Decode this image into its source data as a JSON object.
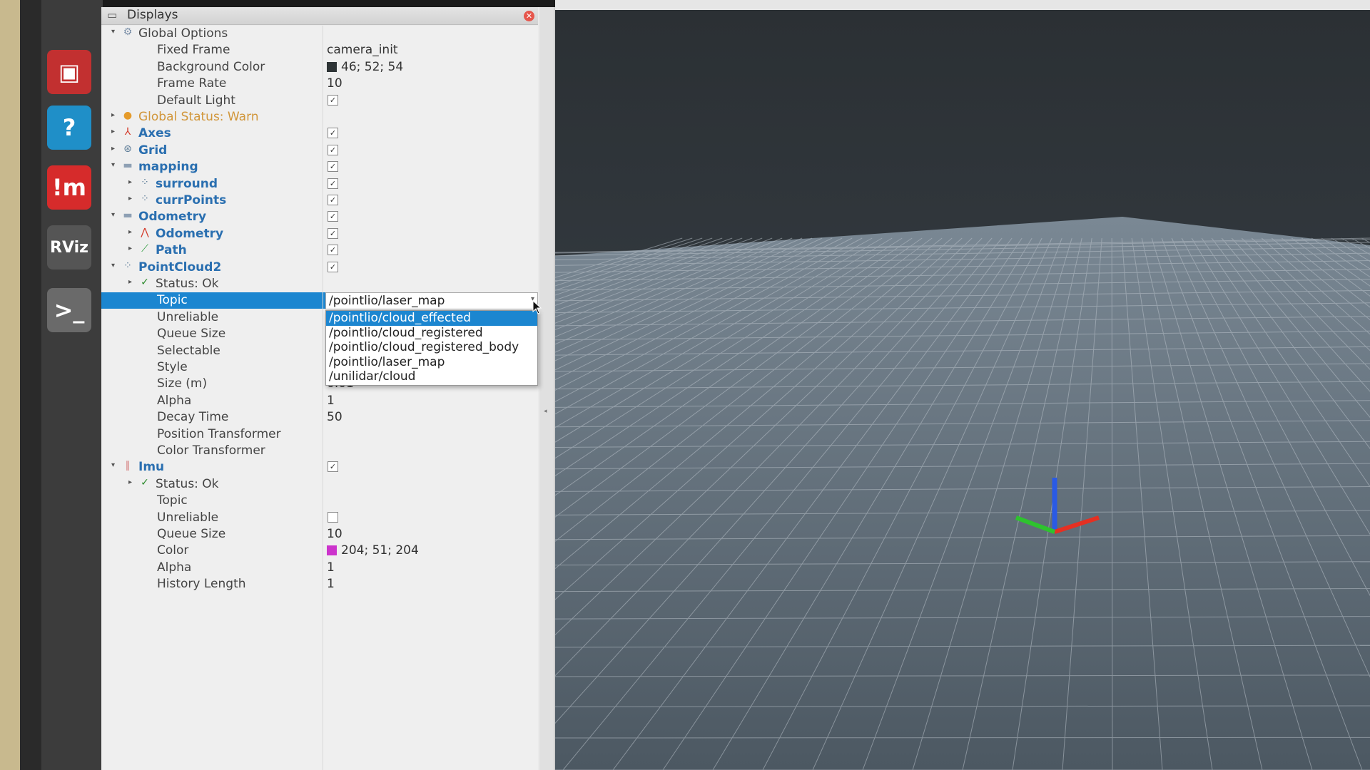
{
  "panel": {
    "title": "Displays"
  },
  "tree": [
    {
      "label": "Global Options",
      "arrow": "▾",
      "indent": 0,
      "icon": "gear-icon",
      "glyph": "⚙",
      "iconColor": "#7a8fa8",
      "style": "plain"
    },
    {
      "label": "Fixed Frame",
      "indent": 2,
      "value": "camera_init"
    },
    {
      "label": "Background Color",
      "indent": 2,
      "value": "46; 52; 54",
      "swatch": "#2e3436"
    },
    {
      "label": "Frame Rate",
      "indent": 2,
      "value": "10"
    },
    {
      "label": "Default Light",
      "indent": 2,
      "checkbox": true
    },
    {
      "label": "Global Status: Warn",
      "arrow": "▸",
      "indent": 0,
      "icon": "warning-icon",
      "glyph": "●",
      "iconColor": "#e59b2b",
      "style": "warn"
    },
    {
      "label": "Axes",
      "arrow": "▸",
      "indent": 0,
      "icon": "axes-icon",
      "glyph": "⅄",
      "iconColor": "#d43a2a",
      "style": "bold",
      "checkbox": true
    },
    {
      "label": "Grid",
      "arrow": "▸",
      "indent": 0,
      "icon": "grid-icon",
      "glyph": "⊛",
      "iconColor": "#5a7a96",
      "style": "bold",
      "checkbox": true
    },
    {
      "label": "mapping",
      "arrow": "▾",
      "indent": 0,
      "icon": "folder-icon",
      "glyph": "▬",
      "iconColor": "#8ea0b4",
      "style": "bold",
      "checkbox": true
    },
    {
      "label": "surround",
      "arrow": "▸",
      "indent": 1,
      "icon": "pointcloud-icon",
      "glyph": "⁘",
      "iconColor": "#5a7a96",
      "style": "bold",
      "checkbox": true
    },
    {
      "label": "currPoints",
      "arrow": "▸",
      "indent": 1,
      "icon": "pointcloud-icon",
      "glyph": "⁘",
      "iconColor": "#5a7a96",
      "style": "bold",
      "checkbox": true
    },
    {
      "label": "Odometry",
      "arrow": "▾",
      "indent": 0,
      "icon": "folder-icon",
      "glyph": "▬",
      "iconColor": "#8ea0b4",
      "style": "bold",
      "checkbox": true
    },
    {
      "label": "Odometry",
      "arrow": "▸",
      "indent": 1,
      "icon": "odometry-icon",
      "glyph": "⋀",
      "iconColor": "#d43a2a",
      "style": "bold",
      "checkbox": true
    },
    {
      "label": "Path",
      "arrow": "▸",
      "indent": 1,
      "icon": "path-icon",
      "glyph": "⟋",
      "iconColor": "#2a9a3a",
      "style": "bold",
      "checkbox": true
    },
    {
      "label": "PointCloud2",
      "arrow": "▾",
      "indent": 0,
      "icon": "pointcloud-icon",
      "glyph": "⁘",
      "iconColor": "#5a7a96",
      "style": "bold",
      "checkbox": true
    },
    {
      "label": "Status: Ok",
      "arrow": "▸",
      "indent": 1,
      "icon": "check-icon",
      "glyph": "✓",
      "iconColor": "#2a8a2a",
      "style": "plain"
    },
    {
      "label": "Topic",
      "indent": 2,
      "selected": true,
      "combo": true
    },
    {
      "label": "Unreliable",
      "indent": 2
    },
    {
      "label": "Queue Size",
      "indent": 2
    },
    {
      "label": "Selectable",
      "indent": 2
    },
    {
      "label": "Style",
      "indent": 2
    },
    {
      "label": "Size (m)",
      "indent": 2,
      "value": "0.01"
    },
    {
      "label": "Alpha",
      "indent": 2,
      "value": "1"
    },
    {
      "label": "Decay Time",
      "indent": 2,
      "value": "50"
    },
    {
      "label": "Position Transformer",
      "indent": 2
    },
    {
      "label": "Color Transformer",
      "indent": 2
    },
    {
      "label": "Imu",
      "arrow": "▾",
      "indent": 0,
      "icon": "imu-icon",
      "glyph": "∥",
      "iconColor": "#d47a7a",
      "style": "bold",
      "checkbox": true
    },
    {
      "label": "Status: Ok",
      "arrow": "▸",
      "indent": 1,
      "icon": "check-icon",
      "glyph": "✓",
      "iconColor": "#2a8a2a",
      "style": "plain"
    },
    {
      "label": "Topic",
      "indent": 2
    },
    {
      "label": "Unreliable",
      "indent": 2,
      "checkbox": false
    },
    {
      "label": "Queue Size",
      "indent": 2,
      "value": "10"
    },
    {
      "label": "Color",
      "indent": 2,
      "value": "204; 51; 204",
      "swatch": "#cc33cc"
    },
    {
      "label": "Alpha",
      "indent": 2,
      "value": "1"
    },
    {
      "label": "History Length",
      "indent": 2,
      "value": "1"
    }
  ],
  "topic_combo": {
    "value": "/pointlio/laser_map",
    "options": [
      "/pointlio/cloud_effected",
      "/pointlio/cloud_registered",
      "/pointlio/cloud_registered_body",
      "/pointlio/laser_map",
      "/unilidar/cloud"
    ],
    "highlighted_index": 0
  },
  "launcher": [
    {
      "name": "remote-desktop-icon",
      "glyph": "▣",
      "bg": "#c23030"
    },
    {
      "name": "help-icon",
      "glyph": "?",
      "bg": "#1f8fc8"
    },
    {
      "name": "im-app-icon",
      "glyph": "!m",
      "bg": "#d62b2b"
    },
    {
      "name": "rviz-icon",
      "glyph": "RViz",
      "bg": "#555555"
    },
    {
      "name": "terminal-icon",
      "glyph": ">_",
      "bg": "#6a6a6a"
    }
  ],
  "colors": {
    "selection": "#1c86d0",
    "view_background": "#2e3436",
    "grid": "#a0a0a0",
    "axis_x": "#e53022",
    "axis_y": "#2ec32e",
    "axis_z": "#2a5ae5"
  }
}
